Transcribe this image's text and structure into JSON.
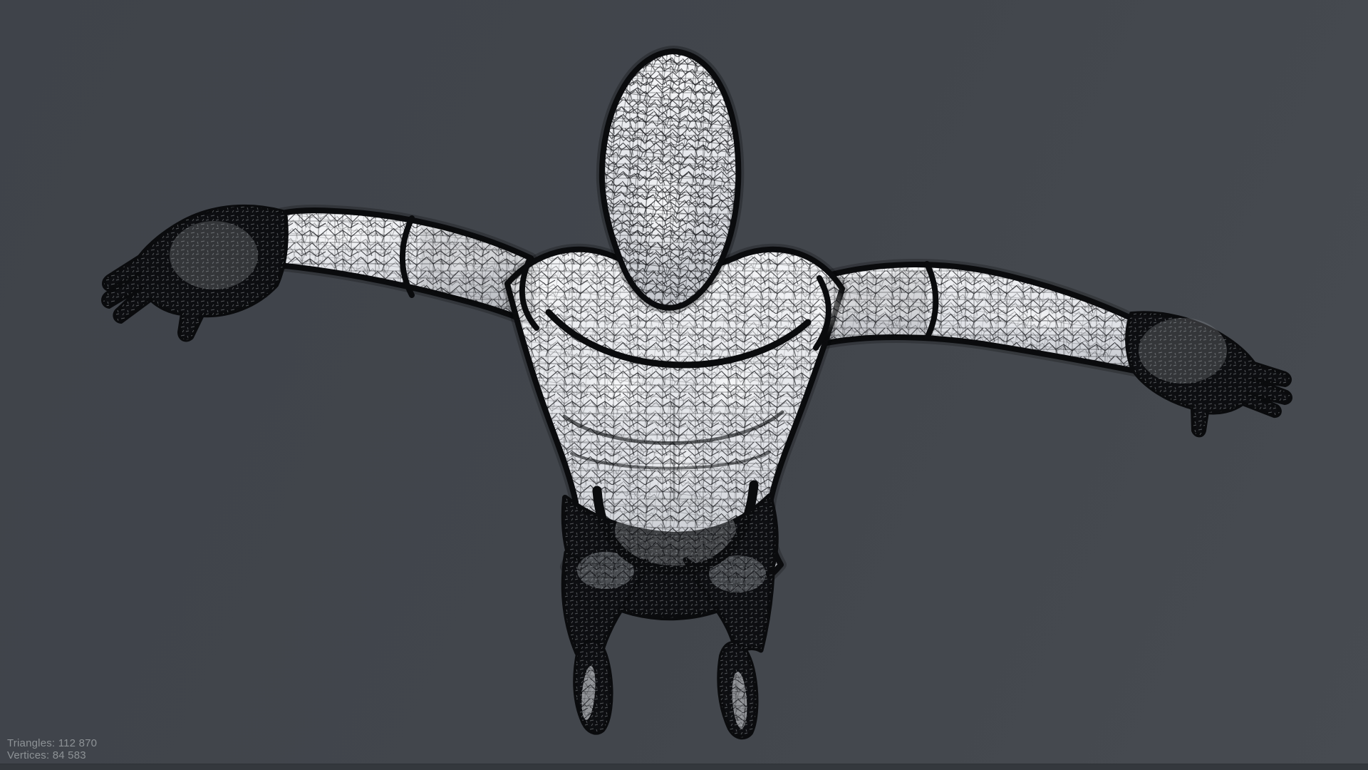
{
  "viewport": {
    "subject": "wireframe humanoid mannequin in T-pose viewed from above",
    "colors": {
      "background": "#42464C",
      "background_dark_corner": "#3F434A",
      "background_light_corner": "#474B51",
      "mesh_surface": "#E6E8EC",
      "wireframe": "#0B0C0E",
      "bottom_bar": "#34383D",
      "stats_text": "#8D9296"
    },
    "stats": {
      "lines": [
        {
          "label": "Triangles:",
          "value": "112 870"
        },
        {
          "label": "Vertices:",
          "value": "84 583"
        }
      ]
    }
  }
}
